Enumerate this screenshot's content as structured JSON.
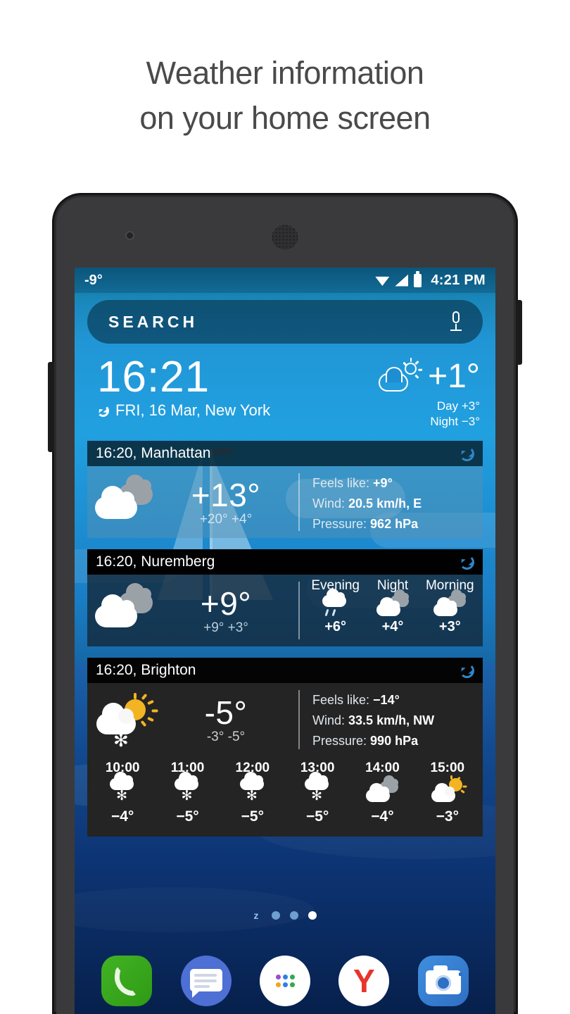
{
  "headline": {
    "line1": "Weather information",
    "line2": "on your home screen"
  },
  "status_bar": {
    "temperature": "-9°",
    "time": "4:21 PM",
    "icons": [
      "wifi-icon",
      "signal-icon",
      "battery-icon"
    ]
  },
  "search": {
    "label": "SEARCH",
    "mic_icon": "microphone-icon"
  },
  "clock_widget": {
    "time": "16:21",
    "date": "FRI, 16 Mar, New York",
    "refresh_icon": "refresh-icon",
    "weather_icon": "sun-cloud-outline-icon",
    "temperature": "+1°",
    "day": "Day +3°",
    "night": "Night −3°"
  },
  "cards": [
    {
      "id": "manhattan",
      "title": "16:20, Manhattan",
      "refresh_icon": "refresh-icon",
      "icon": "double-cloud-icon",
      "temperature": "+13°",
      "max": "+20°",
      "min": "+4°",
      "details": [
        {
          "label": "Feels like:",
          "value": "+9°"
        },
        {
          "label": "Wind:",
          "value": "20.5 km/h, E"
        },
        {
          "label": "Pressure:",
          "value": "962 hPa"
        }
      ]
    },
    {
      "id": "nuremberg",
      "title": "16:20, Nuremberg",
      "refresh_icon": "refresh-icon",
      "icon": "double-cloud-icon",
      "temperature": "+9°",
      "max": "+9°",
      "min": "+3°",
      "parts": [
        {
          "label": "Evening",
          "icon": "rain-cloud-icon",
          "temp": "+6°"
        },
        {
          "label": "Night",
          "icon": "double-cloud-icon",
          "temp": "+4°"
        },
        {
          "label": "Morning",
          "icon": "double-cloud-icon",
          "temp": "+3°"
        }
      ]
    },
    {
      "id": "brighton",
      "title": "16:20, Brighton",
      "refresh_icon": "refresh-icon",
      "icon": "sun-cloud-snow-icon",
      "temperature": "-5°",
      "max": "-3°",
      "min": "-5°",
      "details": [
        {
          "label": "Feels like:",
          "value": "−14°"
        },
        {
          "label": "Wind:",
          "value": "33.5 km/h, NW"
        },
        {
          "label": "Pressure:",
          "value": "990 hPa"
        }
      ],
      "hours": [
        {
          "time": "10:00",
          "icon": "snow-cloud-icon",
          "temp": "−4°"
        },
        {
          "time": "11:00",
          "icon": "snow-cloud-icon",
          "temp": "−5°"
        },
        {
          "time": "12:00",
          "icon": "snow-cloud-icon",
          "temp": "−5°"
        },
        {
          "time": "13:00",
          "icon": "snow-cloud-icon",
          "temp": "−5°"
        },
        {
          "time": "14:00",
          "icon": "double-cloud-icon",
          "temp": "−4°"
        },
        {
          "time": "15:00",
          "icon": "sun-cloud-icon",
          "temp": "−3°"
        }
      ]
    }
  ],
  "page_indicator": {
    "marker": "z",
    "dots": 3,
    "active_index": 2
  },
  "dock": [
    {
      "name": "phone",
      "icon": "phone-icon"
    },
    {
      "name": "messages",
      "icon": "message-icon"
    },
    {
      "name": "app-drawer",
      "icon": "app-grid-icon"
    },
    {
      "name": "yandex-browser",
      "icon": "yandex-y-icon"
    },
    {
      "name": "camera",
      "icon": "camera-icon"
    }
  ],
  "colors": {
    "accent_blue": "#21a0e0",
    "refresh": "#2f86c8",
    "sun": "#f2b422",
    "dock_green": "#42b324",
    "dock_blue": "#4e6fd4",
    "yandex_red": "#e8352b"
  }
}
